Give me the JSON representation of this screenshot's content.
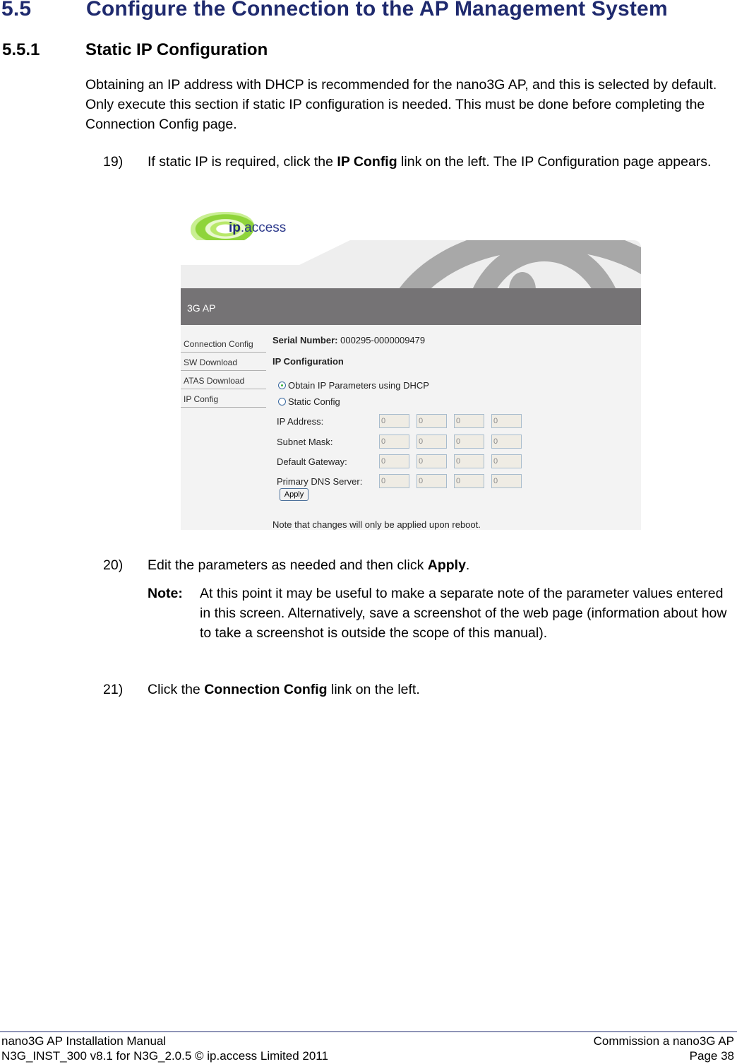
{
  "heading": {
    "number": "5.5",
    "title": "Configure the Connection to the AP Management System"
  },
  "subheading": {
    "number": "5.5.1",
    "title": "Static IP Configuration"
  },
  "intro": "Obtaining an IP address with DHCP is recommended for the nano3G AP, and this is selected by default. Only execute this section if static IP configuration is needed. This must be done before completing the Connection Config page.",
  "steps": [
    {
      "num": "19)",
      "pre": "If static IP is required, click the ",
      "bold": "IP Config",
      "post": " link on the left. The IP Configuration page appears."
    },
    {
      "num": "20)",
      "pre": "Edit the parameters as needed and then click ",
      "bold": "Apply",
      "post": "."
    },
    {
      "num": "21)",
      "pre": "Click the ",
      "bold": "Connection Config",
      "post": " link on the left."
    }
  ],
  "note": {
    "label": "Note:",
    "text": "At this point it may be useful to make a separate note of the parameter values entered in this screen. Alternatively, save a screenshot of the web page (information about how to take a screenshot is outside the scope of this manual)."
  },
  "webui": {
    "logo": {
      "bold": "ip",
      "rest": ".access"
    },
    "title": "3G AP",
    "nav": [
      "Connection Config",
      "SW Download",
      "ATAS Download",
      "IP Config"
    ],
    "serial_label": "Serial Number:",
    "serial_value": "000295-0000009479",
    "section_title": "IP Configuration",
    "radios": [
      {
        "label": "Obtain IP Parameters using DHCP",
        "selected": true
      },
      {
        "label": "Static Config",
        "selected": false
      }
    ],
    "fields": [
      {
        "label": "IP Address:",
        "octets": [
          "0",
          "0",
          "0",
          "0"
        ]
      },
      {
        "label": "Subnet Mask:",
        "octets": [
          "0",
          "0",
          "0",
          "0"
        ]
      },
      {
        "label": "Default Gateway:",
        "octets": [
          "0",
          "0",
          "0",
          "0"
        ]
      },
      {
        "label": "Primary DNS Server:",
        "octets": [
          "0",
          "0",
          "0",
          "0"
        ]
      }
    ],
    "apply_label": "Apply",
    "reboot_note": "Note that changes will only be applied upon reboot."
  },
  "footer": {
    "left1": "nano3G AP Installation Manual",
    "left2": "N3G_INST_300 v8.1 for N3G_2.0.5 © ip.access Limited 2011",
    "right1": "Commission a nano3G AP",
    "right2": "Page 38"
  }
}
